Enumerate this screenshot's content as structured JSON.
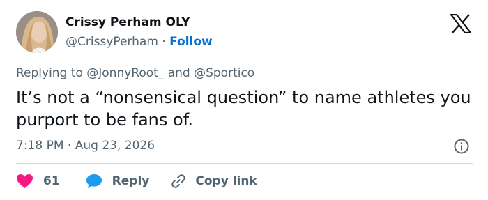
{
  "author": {
    "display_name": "Crissy Perham OLY",
    "handle": "@CrissyPerham",
    "separator": "·",
    "follow_label": "Follow"
  },
  "reply_context": {
    "prefix": "Replying to",
    "mention_1": "@JonnyRoot_",
    "conjunction": "and",
    "mention_2": "@Sportico"
  },
  "tweet": {
    "text": "It’s not a “nonsensical question” to name athletes you purport to be fans of."
  },
  "meta": {
    "time": "7:18 PM",
    "separator": "·",
    "date": "Aug 23, 2026"
  },
  "actions": {
    "like_count": "61",
    "reply_label": "Reply",
    "copy_label": "Copy link"
  },
  "icons": {
    "brand": "x-logo-icon",
    "info": "info-icon",
    "like": "heart-icon",
    "reply": "reply-bubble-icon",
    "copy": "link-icon"
  },
  "colors": {
    "text_primary": "#0f1419",
    "text_secondary": "#536471",
    "link": "#006fd6",
    "like": "#f91880",
    "reply": "#1d9bf0",
    "divider": "#cfd9de"
  }
}
